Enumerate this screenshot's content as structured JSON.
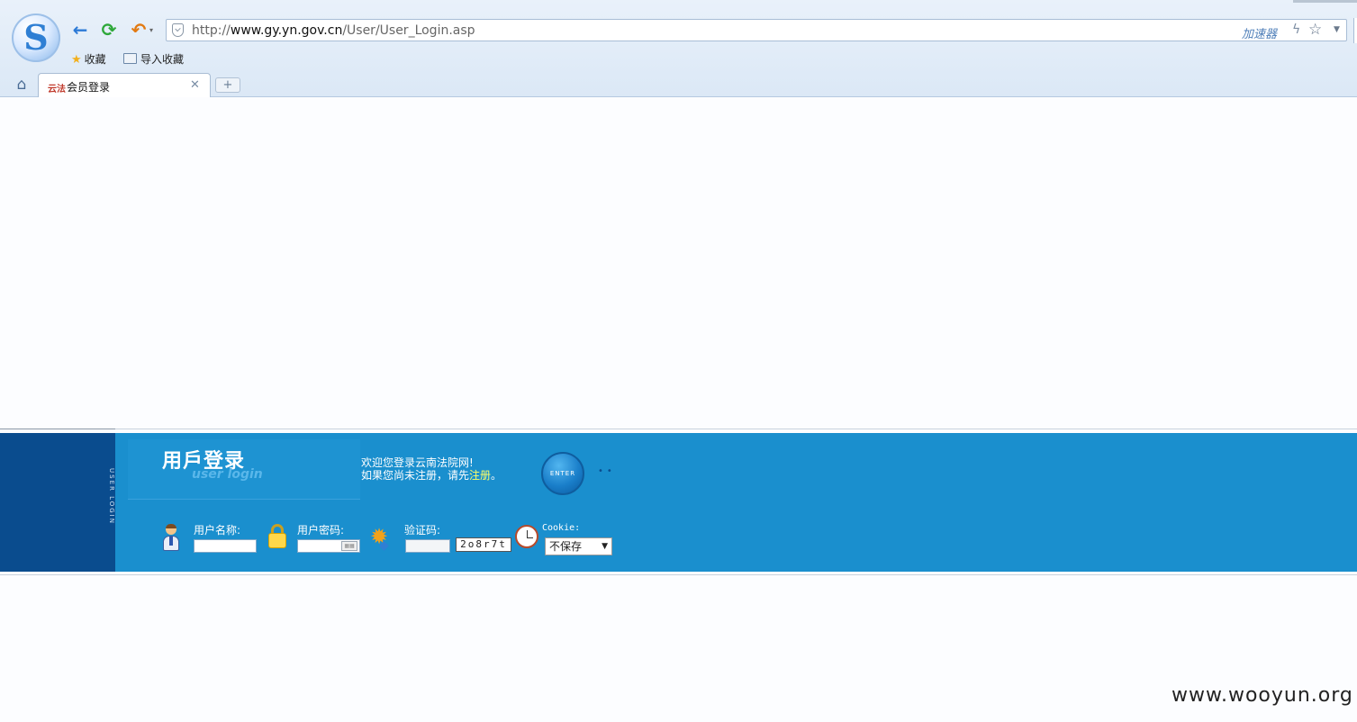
{
  "browser": {
    "url_prefix": "http://",
    "url_host": "www.gy.yn.gov.cn",
    "url_path": "/User/User_Login.asp",
    "accelerator_label": "加速器",
    "bookmarks": [
      {
        "label": "收藏",
        "icon": "star-icon"
      },
      {
        "label": "导入收藏",
        "icon": "folder-icon"
      }
    ],
    "tab": {
      "favicon_text": "云法",
      "title": "会员登录"
    }
  },
  "login": {
    "title_cn": "用戶登录",
    "title_en": "user login",
    "vertical_text": "USER LOGIN",
    "welcome_line1": "欢迎您登录云南法院网!",
    "welcome_line2_prefix": "如果您尚未注册，请先",
    "register_link": "注册",
    "welcome_line2_suffix": "。",
    "enter_label": "ENTER",
    "username_label": "用户名称:",
    "password_label": "用户密码:",
    "captcha_label": "验证码:",
    "captcha_value": "2o8r7t",
    "cookie_label": "Cookie:",
    "cookie_selected": "不保存",
    "colors": {
      "band": "#1a8fce",
      "band_dark": "#0a4c8e",
      "link": "#ffff66"
    }
  },
  "watermark": "www.wooyun.org"
}
